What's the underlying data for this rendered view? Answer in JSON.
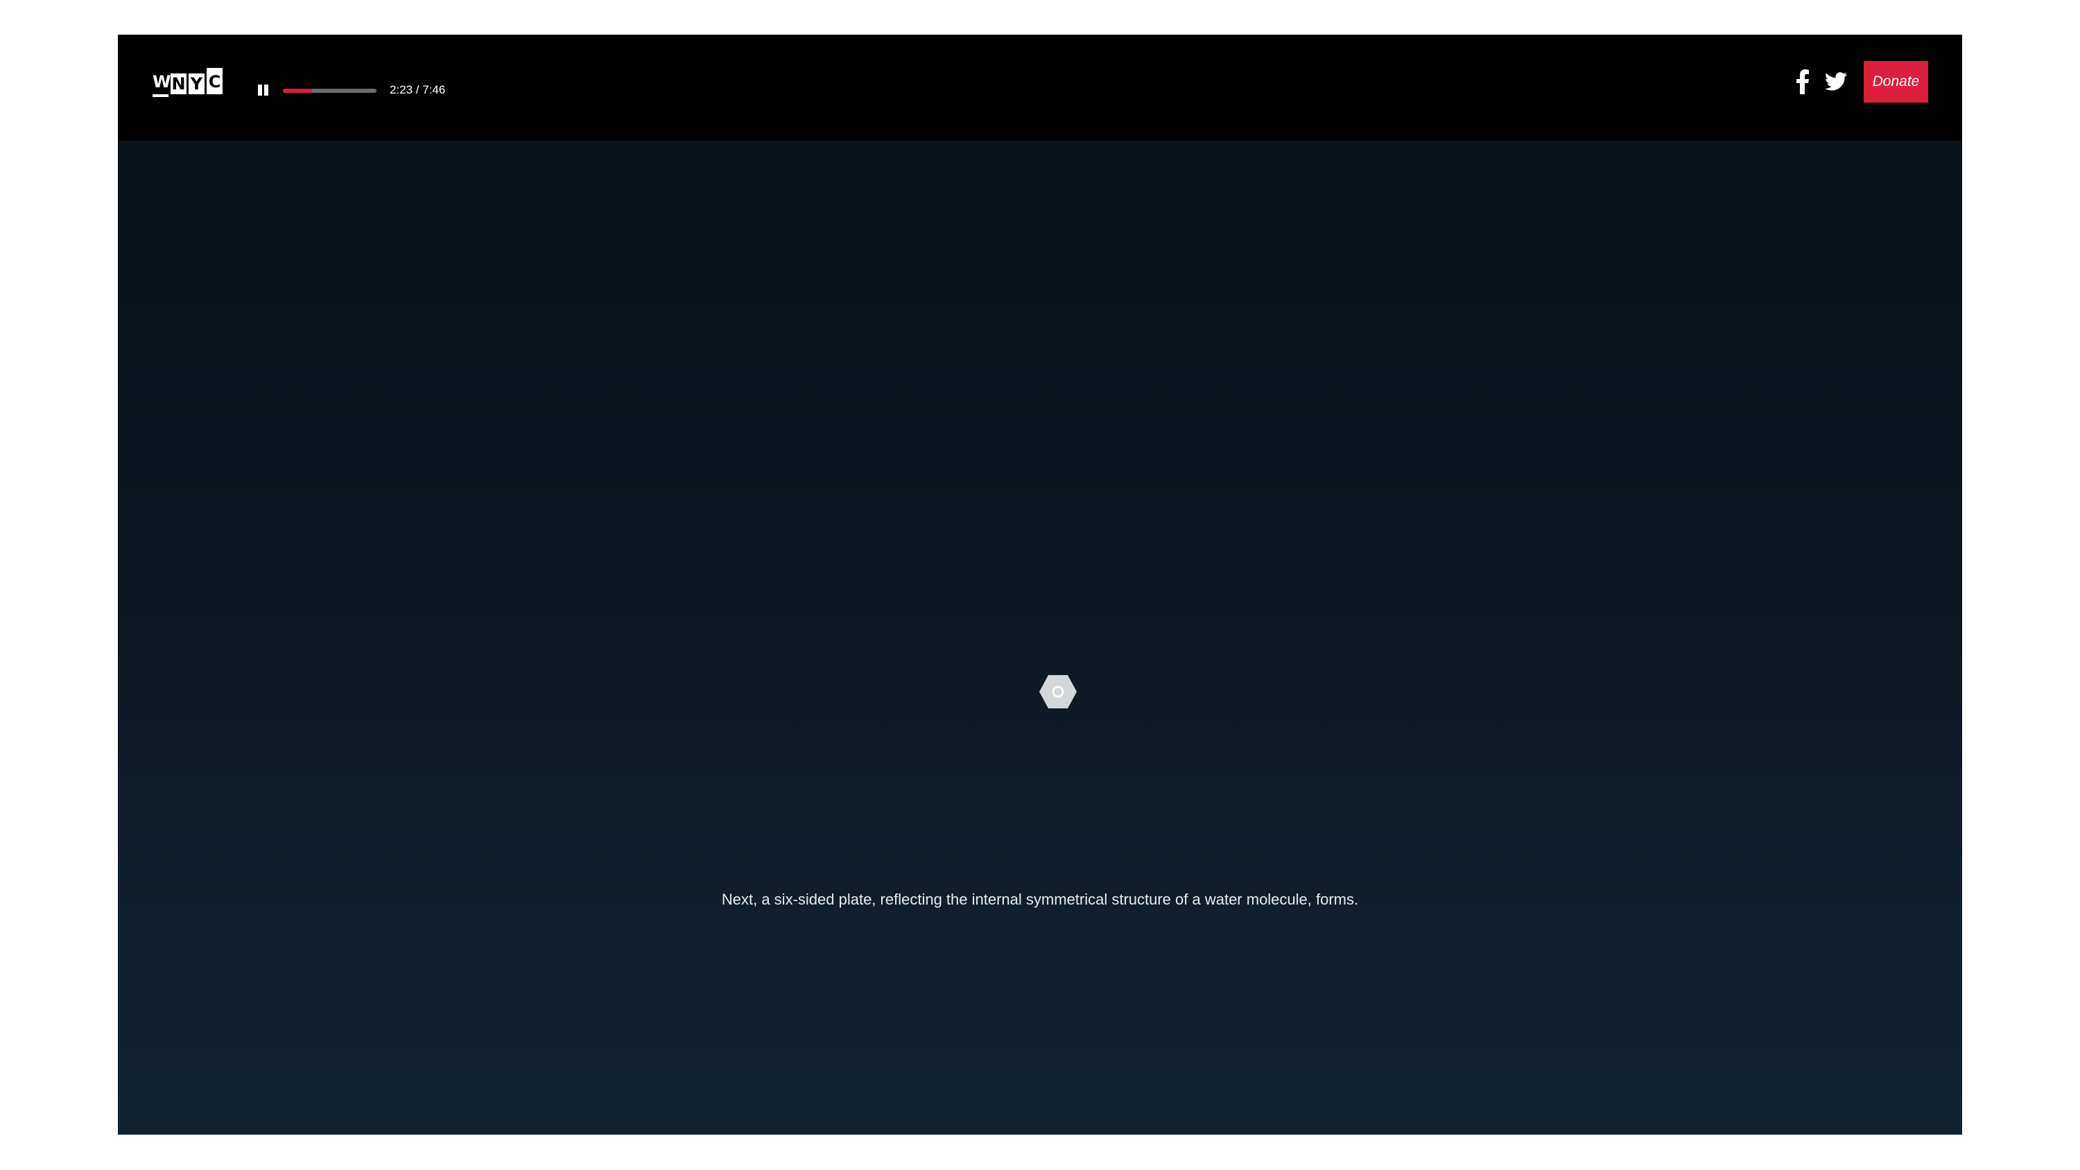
{
  "header": {
    "logo_letters": [
      "W",
      "N",
      "Y",
      "C"
    ],
    "logo_alt": "WNYC"
  },
  "player": {
    "state": "playing",
    "time_display": "2:23 / 7:46",
    "elapsed": "2:23",
    "duration": "7:46",
    "progress_fraction": 0.31
  },
  "social": {
    "facebook_icon": "facebook-icon",
    "twitter_icon": "twitter-icon"
  },
  "donate": {
    "label": "Donate"
  },
  "stage": {
    "caption": "Next, a six-sided plate, reflecting the internal symmetrical structure of a water molecule, forms.",
    "figure_icon": "hexagon-plate-icon"
  },
  "colors": {
    "accent": "#de1e3d",
    "topbar_bg": "#000000",
    "stage_top": "#0a121b",
    "stage_bottom": "#132231",
    "hexagon_fill": "#d4d7da"
  }
}
